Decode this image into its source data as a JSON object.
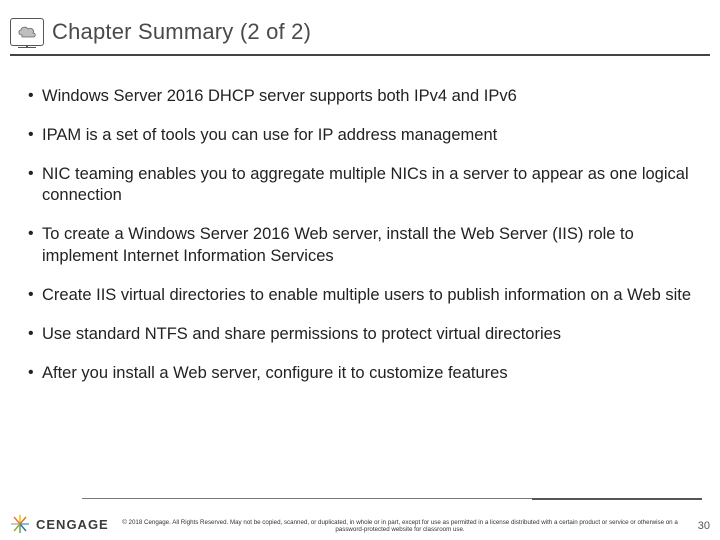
{
  "title": "Chapter Summary (2 of 2)",
  "icon": "cloud-monitor-icon",
  "bullets": [
    "Windows Server 2016 DHCP server supports both IPv4 and IPv6",
    "IPAM is a set of tools you can use for IP address management",
    "NIC teaming enables you to aggregate multiple NICs in a server to appear as one logical connection",
    "To create a Windows Server 2016 Web server, install the Web Server (IIS) role to implement Internet Information Services",
    "Create IIS virtual directories to enable multiple users to publish information on a Web site",
    "Use standard NTFS and share permissions to protect virtual directories",
    "After you install a Web server, configure it to customize features"
  ],
  "footer": {
    "brand": "CENGAGE",
    "copyright": "© 2018 Cengage. All Rights Reserved. May not be copied, scanned, or duplicated, in whole or in part, except for use as permitted in a license distributed with a certain product or service or otherwise on a password-protected website for classroom use.",
    "page": "30"
  }
}
